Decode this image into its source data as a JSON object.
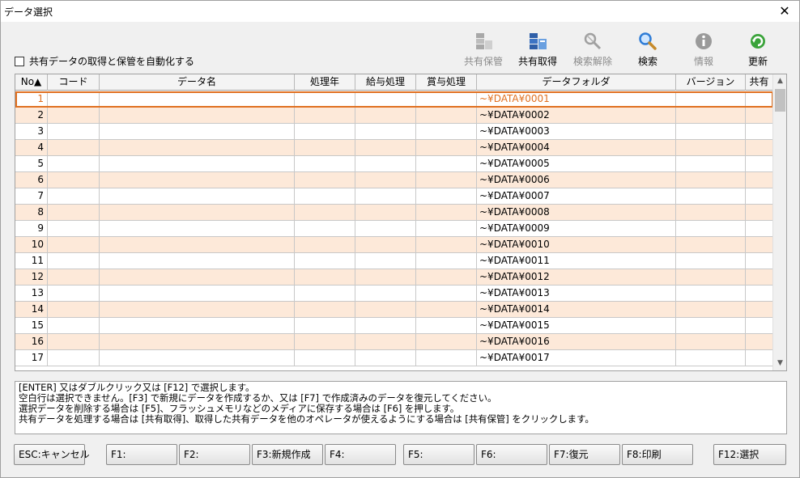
{
  "window": {
    "title": "データ選択",
    "close_glyph": "✕"
  },
  "auto_checkbox": {
    "label": "共有データの取得と保管を自動化する",
    "checked": false
  },
  "toolbar": {
    "share_store": {
      "label": "共有保管",
      "enabled": false,
      "icon": "database-upload-icon"
    },
    "share_get": {
      "label": "共有取得",
      "enabled": true,
      "icon": "database-download-icon"
    },
    "search_clear": {
      "label": "検索解除",
      "enabled": false,
      "icon": "search-clear-icon"
    },
    "search": {
      "label": "検索",
      "enabled": true,
      "icon": "magnifier-icon"
    },
    "info": {
      "label": "情報",
      "enabled": false,
      "icon": "info-icon"
    },
    "refresh": {
      "label": "更新",
      "enabled": true,
      "icon": "refresh-icon"
    }
  },
  "grid": {
    "columns": {
      "no": "No▲",
      "code": "コード",
      "name": "データ名",
      "year": "処理年",
      "kyuyo": "給与処理",
      "shoyo": "賞与処理",
      "folder": "データフォルダ",
      "version": "バージョン",
      "share": "共有"
    },
    "selected_index": 0,
    "rows": [
      {
        "no": "1",
        "folder": "~¥DATA¥0001"
      },
      {
        "no": "2",
        "folder": "~¥DATA¥0002"
      },
      {
        "no": "3",
        "folder": "~¥DATA¥0003"
      },
      {
        "no": "4",
        "folder": "~¥DATA¥0004"
      },
      {
        "no": "5",
        "folder": "~¥DATA¥0005"
      },
      {
        "no": "6",
        "folder": "~¥DATA¥0006"
      },
      {
        "no": "7",
        "folder": "~¥DATA¥0007"
      },
      {
        "no": "8",
        "folder": "~¥DATA¥0008"
      },
      {
        "no": "9",
        "folder": "~¥DATA¥0009"
      },
      {
        "no": "10",
        "folder": "~¥DATA¥0010"
      },
      {
        "no": "11",
        "folder": "~¥DATA¥0011"
      },
      {
        "no": "12",
        "folder": "~¥DATA¥0012"
      },
      {
        "no": "13",
        "folder": "~¥DATA¥0013"
      },
      {
        "no": "14",
        "folder": "~¥DATA¥0014"
      },
      {
        "no": "15",
        "folder": "~¥DATA¥0015"
      },
      {
        "no": "16",
        "folder": "~¥DATA¥0016"
      },
      {
        "no": "17",
        "folder": "~¥DATA¥0017"
      }
    ]
  },
  "message": {
    "lines": [
      "[ENTER] 又はダブルクリック又は [F12] で選択します。",
      "空白行は選択できません。[F3] で新規にデータを作成するか、又は [F7] で作成済みのデータを復元してください。",
      "選択データを削除する場合は [F5]、フラッシュメモリなどのメディアに保存する場合は [F6] を押します。",
      "共有データを処理する場合は [共有取得]、取得した共有データを他のオペレータが使えるようにする場合は [共有保管] をクリックします。"
    ]
  },
  "function_keys": {
    "esc": "ESC:キャンセル",
    "f1": "F1:",
    "f2": "F2:",
    "f3": "F3:新規作成",
    "f4": "F4:",
    "f5": "F5:",
    "f6": "F6:",
    "f7": "F7:復元",
    "f8": "F8:印刷",
    "f12": "F12:選択"
  },
  "colors": {
    "odd_row": "#fde9d9",
    "selection": "#e07020"
  }
}
